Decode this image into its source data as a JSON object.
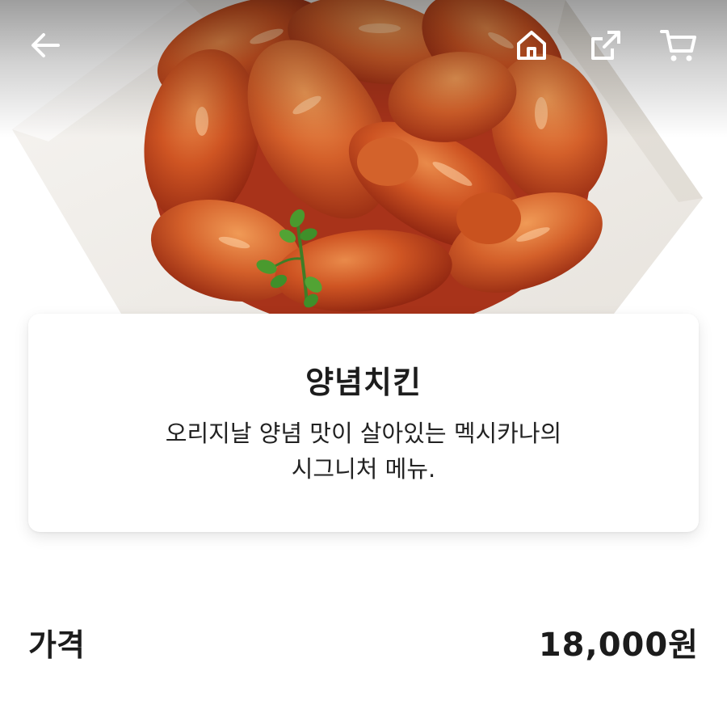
{
  "product": {
    "name": "양념치킨",
    "description_line1": "오리지날 양념 맛이 살아있는 멕시카나의",
    "description_line2": "시그니처 메뉴.",
    "price_label": "가격",
    "price_value": "18,000원"
  },
  "topbar": {
    "back_icon": "arrow-left-icon",
    "home_icon": "home-icon",
    "share_icon": "share-icon",
    "cart_icon": "cart-icon"
  },
  "colors": {
    "sauce_dark": "#9e2a10",
    "sauce_mid": "#c8471d",
    "sauce_light": "#e0733a",
    "paper": "#f4f2ef",
    "basket": "#8a8780",
    "herb": "#3f8f2a"
  }
}
